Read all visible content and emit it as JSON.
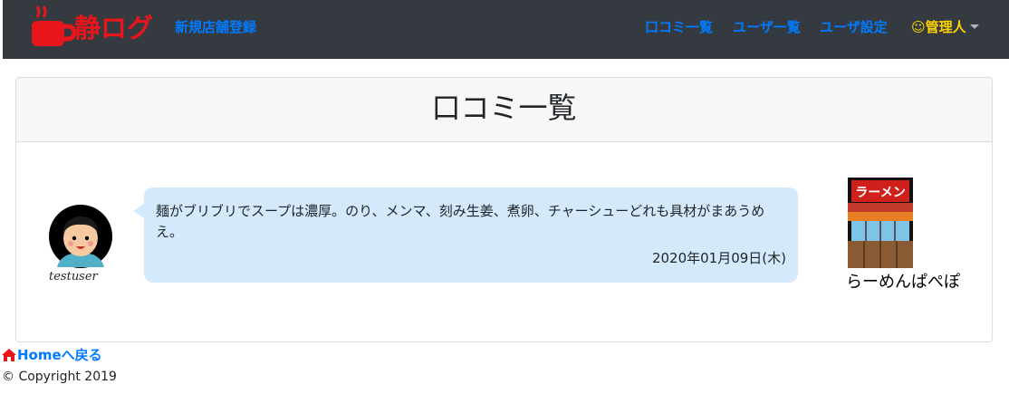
{
  "navbar": {
    "brand": "静ログ",
    "new_store_link": "新規店舗登録",
    "reviews_link": "口コミ一覧",
    "users_link": "ユーザ一覧",
    "settings_link": "ユーザ設定",
    "admin_menu": "☺管理人",
    "colors": {
      "background": "#343a40",
      "link": "#007bff",
      "admin": "#ffd400",
      "brand": "#e8161b"
    }
  },
  "card": {
    "title": "口コミ一覧",
    "review": {
      "username": "testuser",
      "text": "麺がブリブリでスープは濃厚。のり、メンマ、刻み生姜、煮卵、チャーシューどれも具材がまあうめえ。",
      "date": "2020年01月09日(木)",
      "shop_name": "らーめんぱぺぽ",
      "shop_image_text": "ラーメン",
      "bubble_color": "#d4eafc"
    }
  },
  "footer": {
    "home_link": "Homeへ戻る",
    "copyright": "© Copyright 2019"
  }
}
